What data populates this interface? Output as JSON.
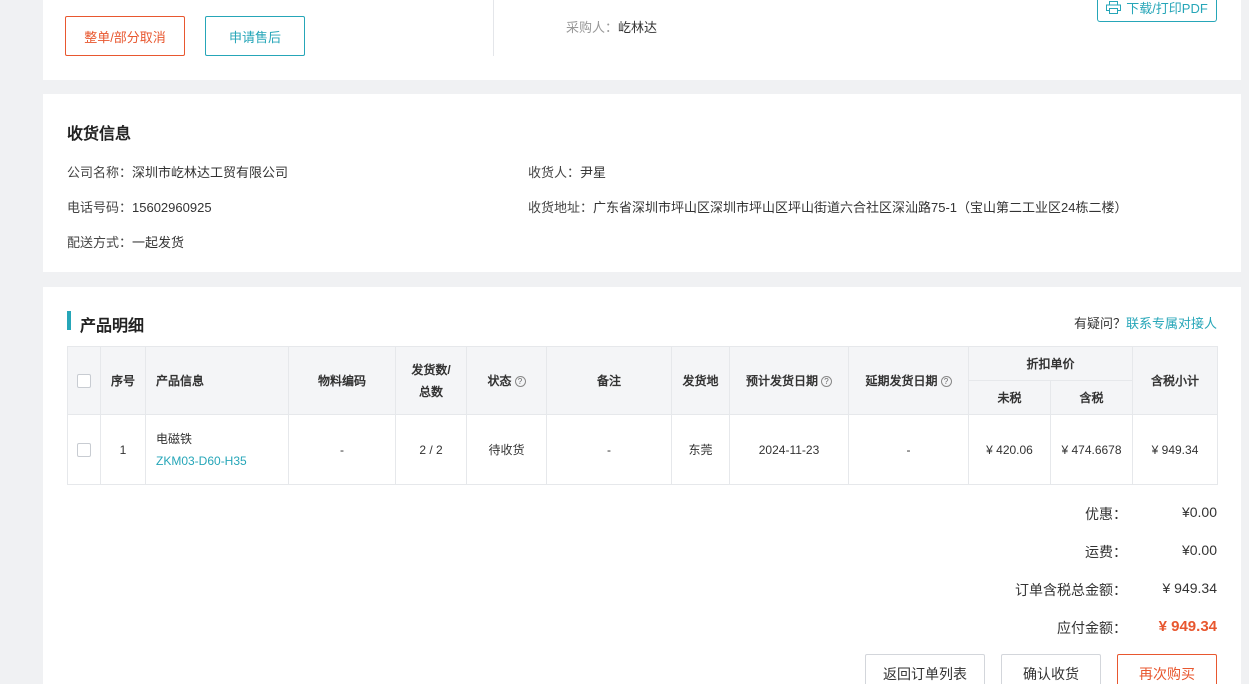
{
  "top": {
    "cancel_label": "整单/部分取消",
    "after_sale_label": "申请售后",
    "buyer_label": "采购人：",
    "buyer_value": "屹林达",
    "pdf_label": "下载/打印PDF"
  },
  "shipping": {
    "title": "收货信息",
    "company_label": "公司名称：",
    "company_value": "深圳市屹林达工贸有限公司",
    "phone_label": "电话号码：",
    "phone_value": "15602960925",
    "delivery_label": "配送方式：",
    "delivery_value": "一起发货",
    "receiver_label": "收货人：",
    "receiver_value": "尹星",
    "address_label": "收货地址：",
    "address_value": "广东省深圳市坪山区深圳市坪山区坪山街道六合社区深汕路75-1（宝山第二工业区24栋二楼）"
  },
  "products": {
    "title": "产品明细",
    "help_text": "有疑问？",
    "help_link": "联系专属对接人",
    "headers": {
      "seq": "序号",
      "info": "产品信息",
      "material": "物料编码",
      "qty_1": "发货数/",
      "qty_2": "总数",
      "status": "状态",
      "remark": "备注",
      "origin": "发货地",
      "est_date": "预计发货日期",
      "delay_date": "延期发货日期",
      "discount": "折扣单价",
      "no_tax": "未税",
      "with_tax": "含税",
      "subtotal": "含税小计"
    },
    "rows": [
      {
        "seq": "1",
        "name": "电磁铁",
        "code": "ZKM03-D60-H35",
        "material": "-",
        "qty": "2 / 2",
        "status": "待收货",
        "remark": "-",
        "origin": "东莞",
        "est_date": "2024-11-23",
        "delay_date": "-",
        "price_no_tax": "¥ 420.06",
        "price_tax": "¥ 474.6678",
        "subtotal": "¥ 949.34"
      }
    ]
  },
  "summary": {
    "discount_label": "优惠：",
    "discount_value": "¥0.00",
    "freight_label": "运费：",
    "freight_value": "¥0.00",
    "total_label": "订单含税总金额：",
    "total_value": "¥ 949.34",
    "pay_label": "应付金额：",
    "pay_value": "¥ 949.34"
  },
  "actions": {
    "back_label": "返回订单列表",
    "confirm_label": "确认收货",
    "again_label": "再次购买"
  },
  "colors": {
    "accent": "#26a6b8",
    "danger": "#e8572f"
  }
}
